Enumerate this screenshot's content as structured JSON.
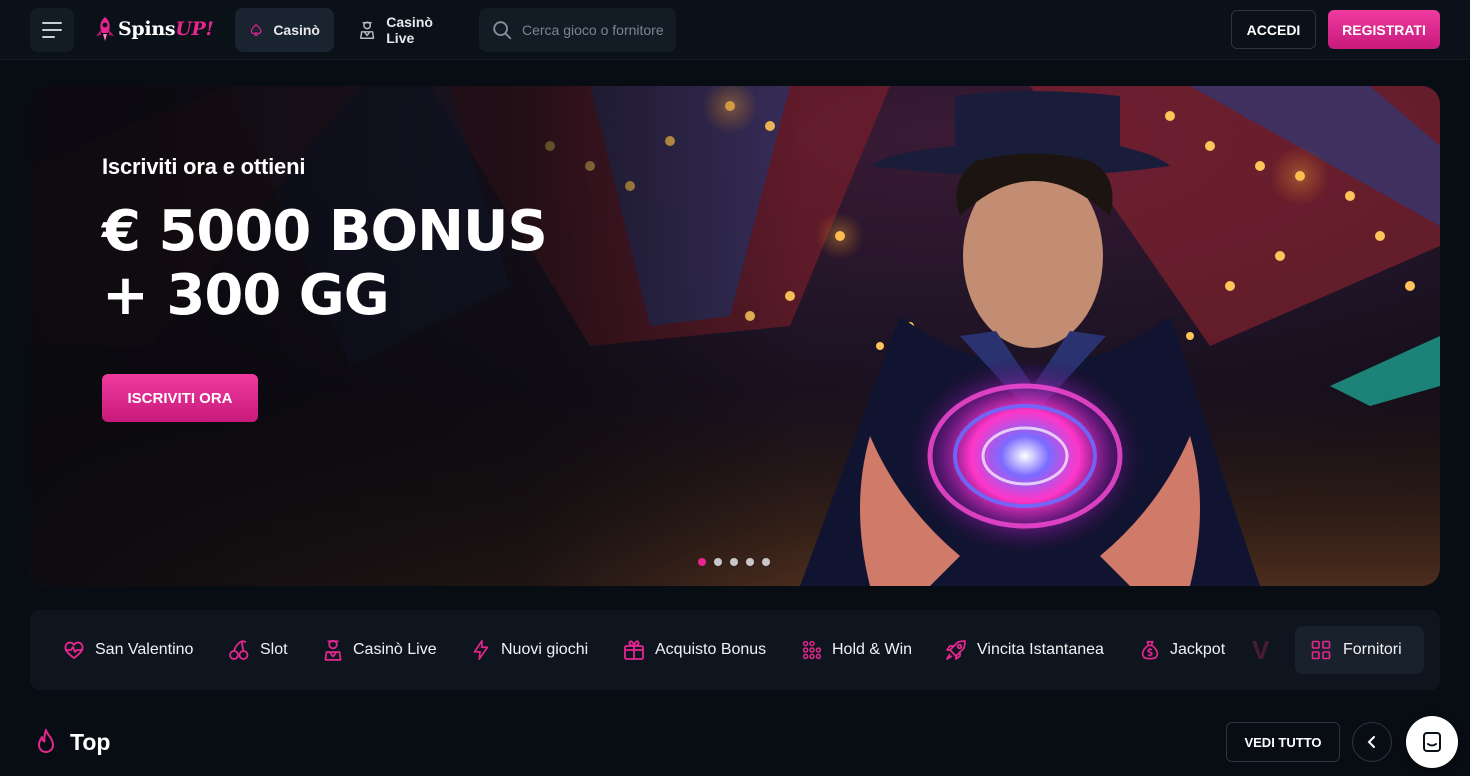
{
  "header": {
    "menu_icon": "hamburger-menu-icon",
    "logo_text_main": "Spins",
    "logo_text_accent": "UP!",
    "tabs": [
      {
        "label": "Casinò",
        "icon": "spade-icon",
        "active": true
      },
      {
        "label": "Casinò Live",
        "icon": "dealer-icon",
        "active": false
      }
    ],
    "search_placeholder": "Cerca gioco o fornitore",
    "login_label": "ACCEDI",
    "register_label": "REGISTRATI"
  },
  "hero": {
    "subtitle": "Iscriviti ora e ottieni",
    "title_line1": "€ 5000 BONUS",
    "title_line2": "+ 300 GG",
    "cta_label": "ISCRIVITI ORA",
    "slides_total": 5,
    "active_slide": 1
  },
  "categories": [
    {
      "label": "San Valentino",
      "icon": "heart-icon"
    },
    {
      "label": "Slot",
      "icon": "cherries-icon"
    },
    {
      "label": "Casinò Live",
      "icon": "dealer-icon"
    },
    {
      "label": "Nuovi giochi",
      "icon": "lightning-icon"
    },
    {
      "label": "Acquisto Bonus",
      "icon": "gift-icon"
    },
    {
      "label": "Hold & Win",
      "icon": "grid-dots-icon"
    },
    {
      "label": "Vincita Istantanea",
      "icon": "rocket-icon"
    },
    {
      "label": "Jackpot",
      "icon": "money-bag-icon"
    }
  ],
  "providers_label": "Fornitori",
  "top_section": {
    "title": "Top",
    "see_all_label": "VEDI TUTTO"
  },
  "colors": {
    "accent": "#e6268f",
    "background": "#080d14",
    "panel": "#0f151e"
  }
}
